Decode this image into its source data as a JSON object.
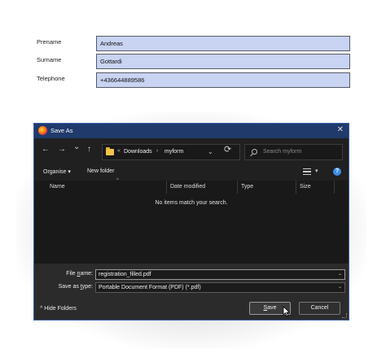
{
  "form": {
    "rows": [
      {
        "label": "Prename",
        "value": "Andreas"
      },
      {
        "label": "Surname",
        "value": "Gottardi"
      },
      {
        "label": "Telephone",
        "value": "+436644889586"
      }
    ],
    "input_color": "#c9d3f2"
  },
  "dialog": {
    "title": "Save As",
    "close_glyph": "✕",
    "nav": {
      "back": "←",
      "forward": "→",
      "recent": "⌄",
      "up": "↑"
    },
    "address": {
      "overflow": "«",
      "crumbs": [
        "Downloads",
        "myform"
      ],
      "separator": "›"
    },
    "refresh": "⟳",
    "search_placeholder": "Search myform",
    "toolbar": {
      "organise": "Organise ▾",
      "new_folder": "New folder",
      "help": "?"
    },
    "columns": [
      "Name",
      "Date modified",
      "Type",
      "Size"
    ],
    "sort_glyph": "^",
    "empty_message": "No items match your search.",
    "file_name": {
      "label_pre": "File ",
      "label_u": "n",
      "label_post": "ame:",
      "value": "registration_filled.pdf"
    },
    "save_type": {
      "label_pre": "Save as ",
      "label_u": "t",
      "label_post": "ype:",
      "value": "Portable Document Format (PDF) (*.pdf)"
    },
    "hide_folders": "^  Hide Folders",
    "save_label_u": "S",
    "save_label_rest": "ave",
    "cancel_label": "Cancel",
    "accent_color": "#1f3a6b"
  }
}
